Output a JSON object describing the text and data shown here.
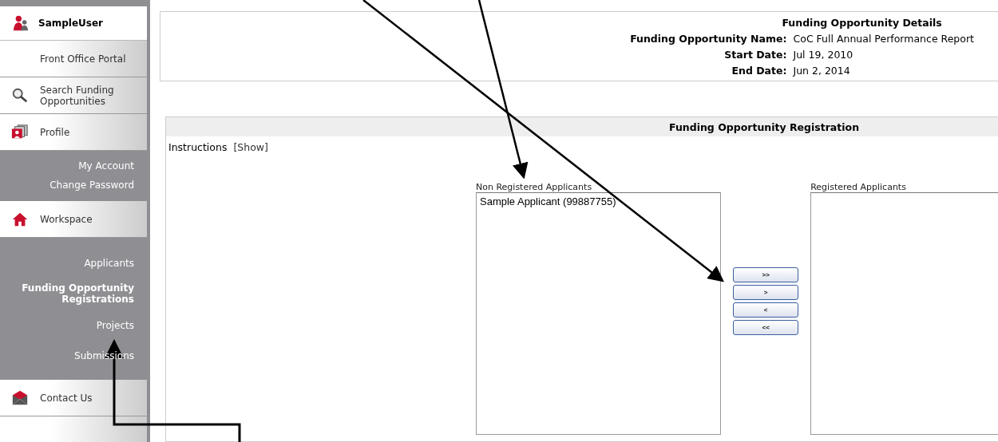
{
  "user": {
    "name": "SampleUser"
  },
  "sidebar": {
    "items": [
      {
        "label": "Front Office Portal",
        "kind": "plain"
      },
      {
        "label": "Search Funding Opportunities",
        "kind": "search"
      },
      {
        "label": "Profile",
        "kind": "profile",
        "children": [
          {
            "label": "My Account",
            "selected": false
          },
          {
            "label": "Change Password",
            "selected": false
          }
        ]
      },
      {
        "label": "Workspace",
        "kind": "home",
        "children": [
          {
            "label": "Applicants",
            "selected": false
          },
          {
            "label": "Funding Opportunity Registrations",
            "selected": true
          },
          {
            "label": "Projects",
            "selected": false
          },
          {
            "label": "Submissions",
            "selected": false
          }
        ]
      },
      {
        "label": "Contact Us",
        "kind": "mail"
      }
    ]
  },
  "details": {
    "title": "Funding Opportunity Details",
    "fields": [
      {
        "label": "Funding Opportunity Name:",
        "value": "CoC Full Annual Performance Report"
      },
      {
        "label": "Start Date:",
        "value": "Jul 19, 2010"
      },
      {
        "label": "End Date:",
        "value": "Jun 2, 2014"
      }
    ]
  },
  "registration": {
    "title": "Funding Opportunity Registration",
    "instructions": "Instructions",
    "show_link": "[Show]",
    "non_registered": {
      "label": "Non Registered Applicants",
      "items": [
        "Sample Applicant (99887755)"
      ]
    },
    "registered": {
      "label": "Registered Applicants"
    },
    "buttons": [
      ">>",
      ">",
      "<",
      "<<"
    ]
  }
}
